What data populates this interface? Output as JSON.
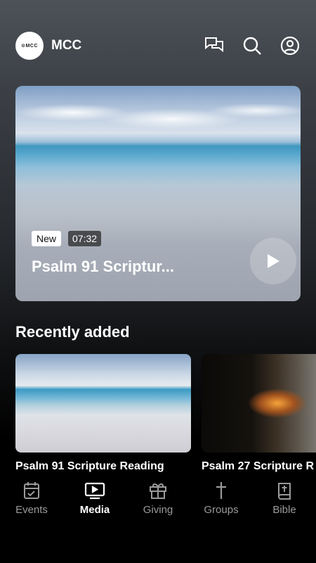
{
  "header": {
    "logo_text": "⊙MCC",
    "app_name": "MCC",
    "icons": [
      "chat-icon",
      "search-icon",
      "account-icon"
    ]
  },
  "hero": {
    "badge_new": "New",
    "duration": "07:32",
    "title": "Psalm 91 Scriptur..."
  },
  "recent": {
    "title": "Recently added",
    "items": [
      {
        "title": "Psalm 91 Scripture Reading"
      },
      {
        "title": "Psalm 27 Scripture R"
      }
    ]
  },
  "tabs": [
    {
      "label": "Events",
      "icon": "calendar-check-icon",
      "active": false
    },
    {
      "label": "Media",
      "icon": "tv-play-icon",
      "active": true
    },
    {
      "label": "Giving",
      "icon": "gift-icon",
      "active": false
    },
    {
      "label": "Groups",
      "icon": "cross-icon",
      "active": false
    },
    {
      "label": "Bible",
      "icon": "bible-icon",
      "active": false
    }
  ],
  "colors": {
    "active": "#ffffff",
    "inactive": "#9a9a9a",
    "background": "#000000"
  }
}
